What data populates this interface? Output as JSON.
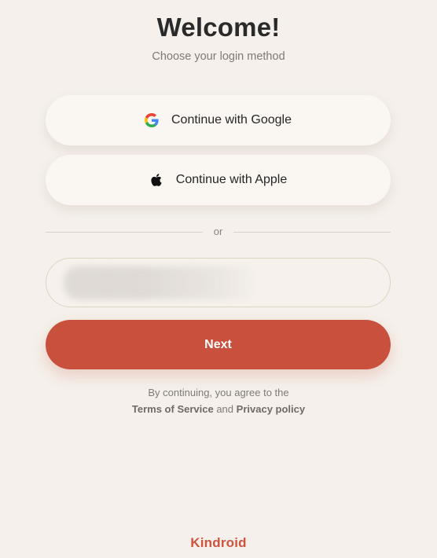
{
  "header": {
    "title": "Welcome!",
    "subtitle": "Choose your login method"
  },
  "social": {
    "google": {
      "label": "Continue with Google",
      "icon": "google-icon"
    },
    "apple": {
      "label": "Continue with Apple",
      "icon": "apple-icon"
    }
  },
  "divider": {
    "text": "or"
  },
  "login": {
    "input_value": "",
    "input_placeholder": "",
    "next_label": "Next"
  },
  "legal": {
    "line1": "By continuing, you agree to the",
    "terms_label": "Terms of Service",
    "and_text": "and",
    "privacy_label": "Privacy policy"
  },
  "brand": {
    "name": "Kindroid"
  },
  "colors": {
    "background": "#f5f0eb",
    "accent": "#c9503d",
    "brand": "#d0533e"
  }
}
